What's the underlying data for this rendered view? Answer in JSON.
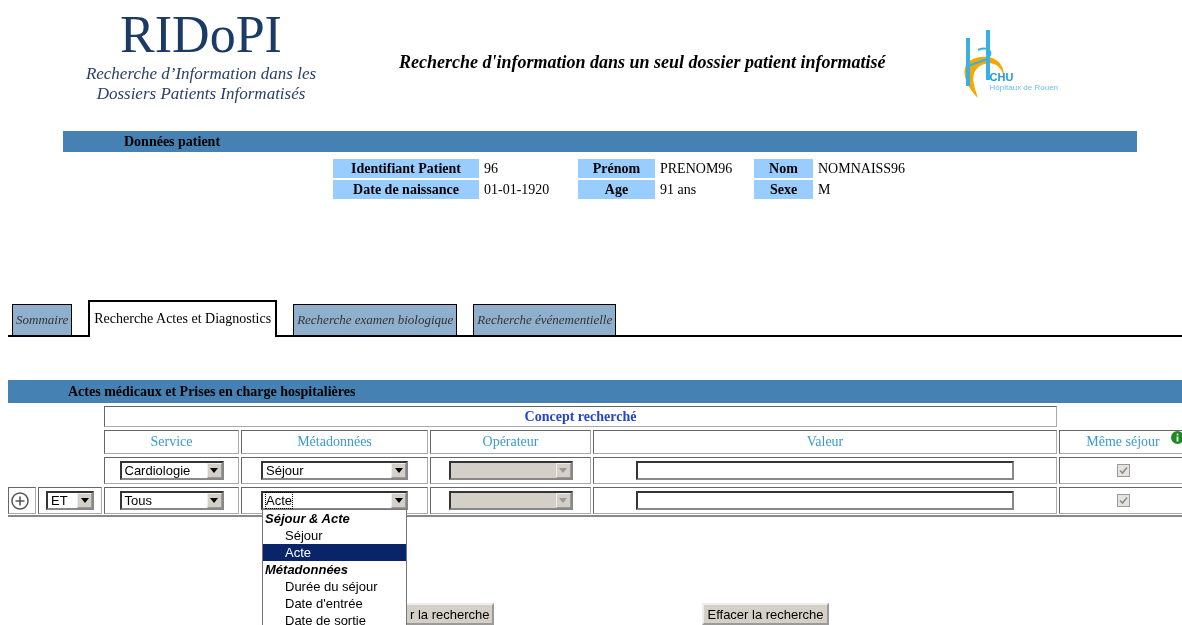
{
  "header": {
    "logo_title": "RIDoPI",
    "logo_subtitle": [
      "Recherche d’Information dans les",
      "Dossiers Patients Informatisés"
    ],
    "title": "Recherche d'information dans un seul dossier patient informatisé",
    "hospital_logo": [
      "CHU",
      "Hôpitaux de Rouen"
    ]
  },
  "patient": {
    "heading": "Données patient",
    "fields": [
      {
        "label": "Identifiant Patient",
        "value": "96"
      },
      {
        "label": "Prénom",
        "value": "PRENOM96"
      },
      {
        "label": "Nom",
        "value": "NOMNAISS96"
      },
      {
        "label": "Date de naissance",
        "value": "01-01-1920"
      },
      {
        "label": "Age",
        "value": "91 ans"
      },
      {
        "label": "Sexe",
        "value": "M"
      }
    ]
  },
  "tabs": [
    {
      "label": "Sommaire",
      "selected": false
    },
    {
      "label": "Recherche Actes et Diagnostics",
      "selected": true
    },
    {
      "label": "Recherche examen biologique",
      "selected": false
    },
    {
      "label": "Recherche événementielle",
      "selected": false
    }
  ],
  "section": {
    "title": "Actes médicaux et Prises en charge hospitalières",
    "concept_header": "Concept recherché",
    "columns": [
      "Service",
      "Métadonnées",
      "Opérateur",
      "Valeur",
      "Même séjour"
    ],
    "rows": [
      {
        "service": "Cardiologie",
        "metadata": "Séjour",
        "operator_disabled": true,
        "same_stay_checked": true
      },
      {
        "connector": "ET",
        "service": "Tous",
        "metadata": "Acte",
        "operator_disabled": true,
        "same_stay_checked": true
      }
    ]
  },
  "dropdown": {
    "items": [
      {
        "kind": "group",
        "label": "Séjour & Acte"
      },
      {
        "kind": "option",
        "label": "Séjour",
        "selected": false
      },
      {
        "kind": "option",
        "label": "Acte",
        "selected": true
      },
      {
        "kind": "group",
        "label": "Métadonnées"
      },
      {
        "kind": "option",
        "label": "Durée du séjour",
        "selected": false
      },
      {
        "kind": "option",
        "label": "Date d'entrée",
        "selected": false
      },
      {
        "kind": "option",
        "label": "Date de sortie",
        "selected": false
      }
    ]
  },
  "buttons": [
    {
      "label": "r la recherche"
    },
    {
      "label": "Effacer la recherche"
    }
  ]
}
